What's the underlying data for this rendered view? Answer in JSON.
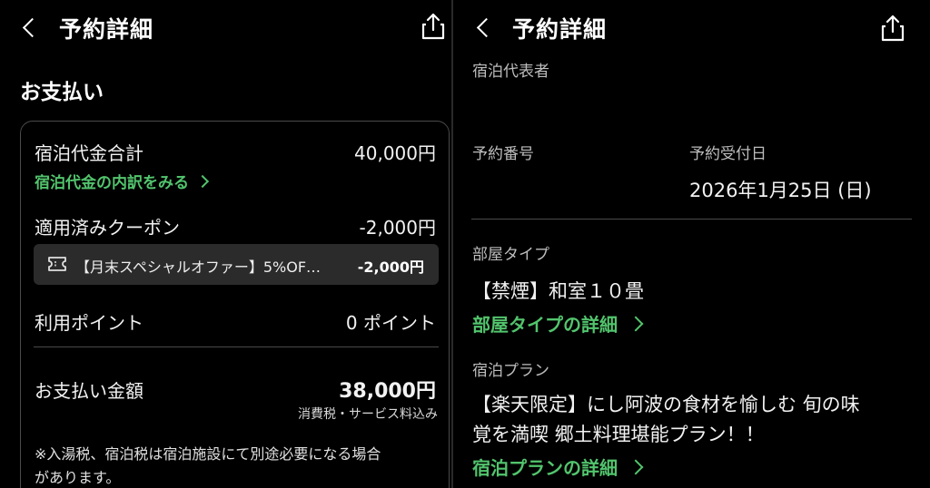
{
  "header": {
    "title": "予約詳細"
  },
  "left": {
    "section_title": "お支払い",
    "accommodation_total_label": "宿泊代金合計",
    "accommodation_total_value": "40,000円",
    "breakdown_link": "宿泊代金の内訳をみる",
    "coupon_label": "適用済みクーポン",
    "coupon_value": "-2,000円",
    "coupon_name": "【月末スペシャルオファー】5%OF…",
    "coupon_amount": "-2,000円",
    "points_label": "利用ポイント",
    "points_value": "0 ポイント",
    "payment_label": "お支払い金額",
    "payment_value": "38,000円",
    "tax_note": "消費税・サービス料込み",
    "footnote_line1": "※入湯税、宿泊税は宿泊施設にて別途必要になる場合",
    "footnote_line2": "があります。"
  },
  "right": {
    "representative_label": "宿泊代表者",
    "reservation_number_label": "予約番号",
    "reception_date_label": "予約受付日",
    "reception_date_value": "2026年1月25日 (日)",
    "room_type_label": "部屋タイプ",
    "room_type_value": "【禁煙】和室１０畳",
    "room_type_link": "部屋タイプの詳細",
    "plan_label": "宿泊プラン",
    "plan_line1": "【楽天限定】にし阿波の食材を愉しむ 旬の味",
    "plan_line2": "覚を満喫 郷土料理堪能プラン！！",
    "plan_link": "宿泊プランの詳細"
  },
  "colors": {
    "background": "#000000",
    "accent": "#52c46d",
    "card_border": "#4a4a4a",
    "coupon_bg": "#2b2b2b"
  },
  "icons": [
    "chevron-left-icon",
    "share-icon",
    "chevron-right-icon",
    "ticket-icon"
  ]
}
